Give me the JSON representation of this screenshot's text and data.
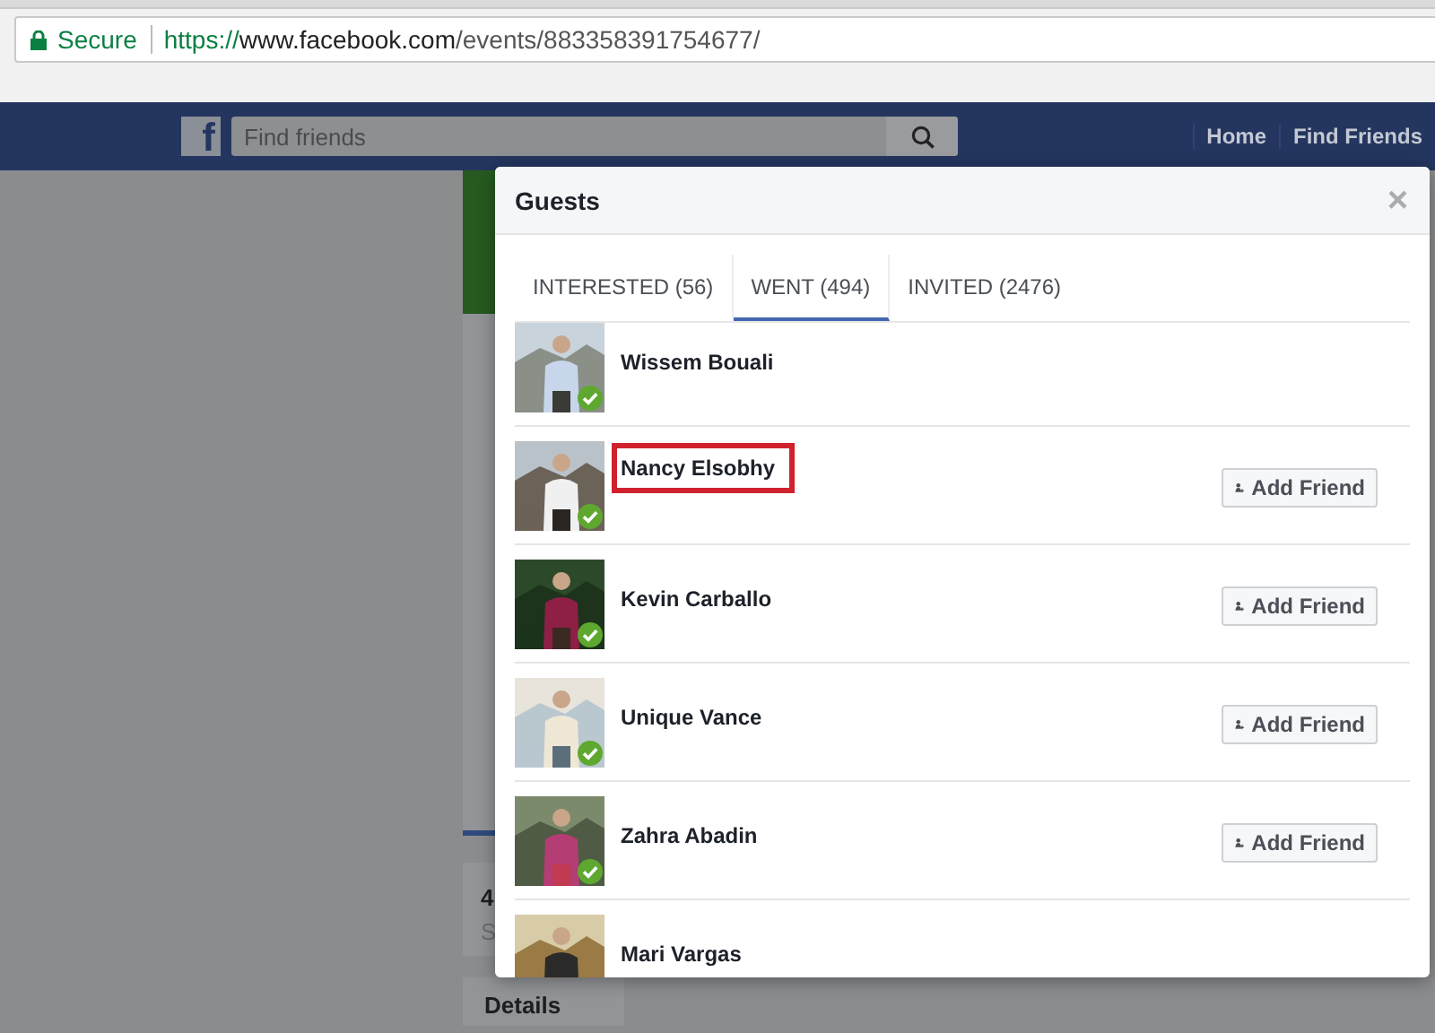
{
  "address_bar": {
    "security": "Secure",
    "url": {
      "scheme": "https://",
      "host": "www.facebook.com",
      "path": "/events/883358391754677/"
    }
  },
  "top_bar": {
    "logo": "f",
    "search": {
      "placeholder": "Find friends"
    },
    "nav": [
      "Home",
      "Find Friends"
    ]
  },
  "event_page": {
    "stats": [
      "4",
      "S"
    ],
    "details_title": "Details"
  },
  "dialog": {
    "title": "Guests",
    "close": "×",
    "tabs": [
      {
        "label": "INTERESTED (56)",
        "selected": false
      },
      {
        "label": "WENT (494)",
        "selected": true
      },
      {
        "label": "INVITED (2476)",
        "selected": false
      }
    ],
    "guests": [
      {
        "name": "Wissem Bouali",
        "checked": true,
        "highlighted": false
      },
      {
        "name": "Nancy Elsobhy",
        "checked": true,
        "highlighted": true,
        "action": "Add Friend"
      },
      {
        "name": "Kevin Carballo",
        "checked": true,
        "highlighted": false,
        "action": "Add Friend"
      },
      {
        "name": "Unique Vance",
        "checked": true,
        "highlighted": false,
        "action": "Add Friend"
      },
      {
        "name": "Zahra Abadin",
        "checked": true,
        "highlighted": false,
        "action": "Add Friend"
      },
      {
        "name": "Mari Vargas",
        "highlighted": false
      }
    ]
  }
}
